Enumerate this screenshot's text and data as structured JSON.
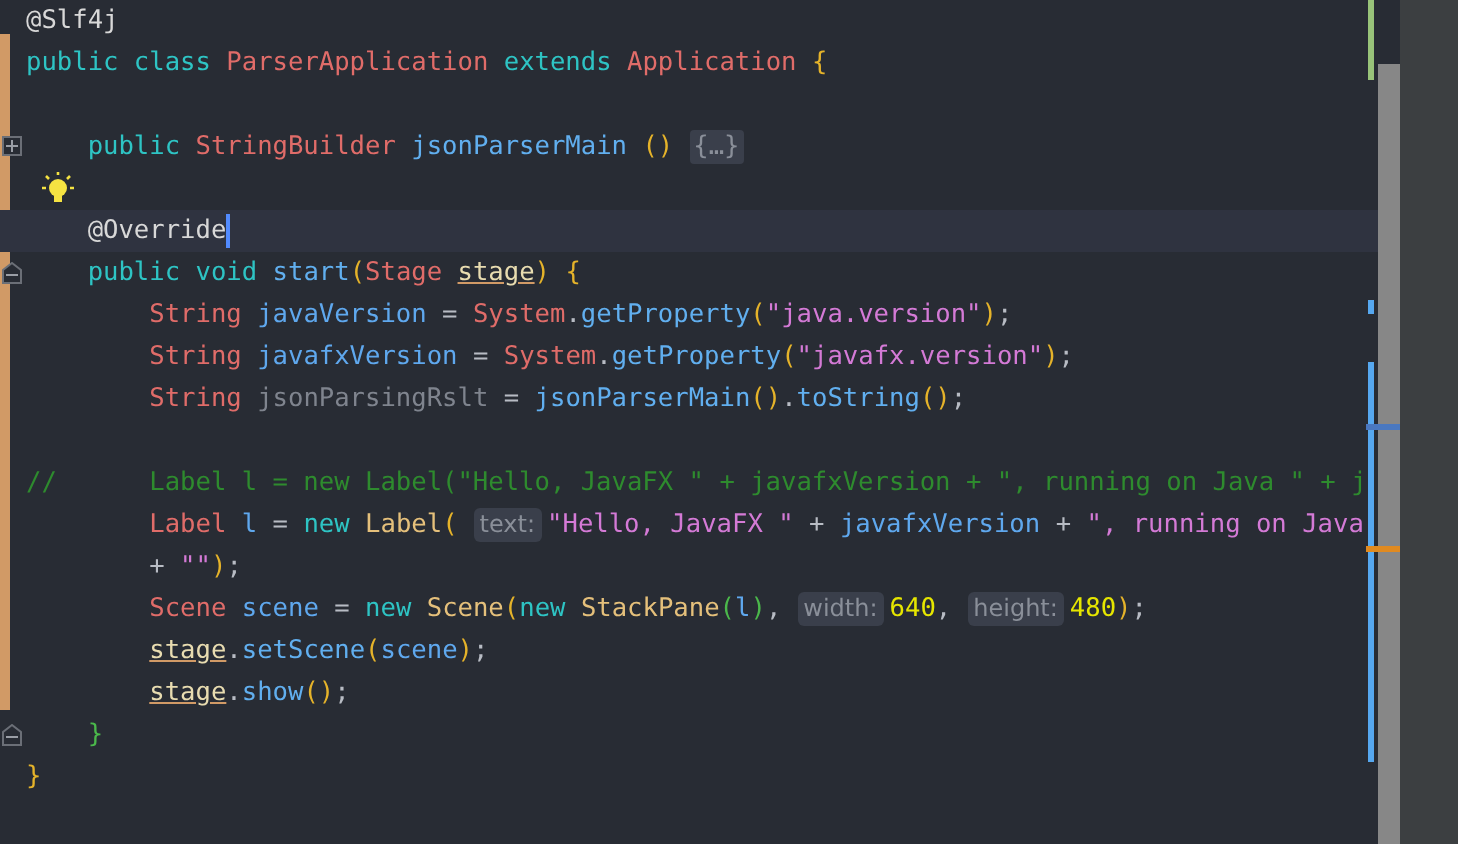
{
  "editor": {
    "lines": [
      {
        "tokens": [
          {
            "text": "@Slf4j",
            "kind": "annotation"
          }
        ]
      },
      {
        "tokens": [
          {
            "text": "public class ",
            "kind": "keyword"
          },
          {
            "text": "ParserApplication",
            "kind": "type"
          },
          {
            "text": " extends ",
            "kind": "keyword"
          },
          {
            "text": "Application",
            "kind": "type"
          },
          {
            "text": " {",
            "kind": "brace"
          }
        ]
      },
      {
        "blank_before": true,
        "folded": true,
        "tokens": [
          {
            "text": "    public ",
            "kind": "keyword"
          },
          {
            "text": "StringBuilder",
            "kind": "type"
          },
          {
            "text": " jsonParserMain ",
            "kind": "method"
          },
          {
            "text": "()",
            "kind": "brace"
          },
          {
            "text": "{…}",
            "kind": "folded"
          }
        ]
      },
      {
        "blank_before": true,
        "bulb": true,
        "current": true,
        "tokens": [
          {
            "text": "    @Override",
            "kind": "annotation"
          }
        ]
      },
      {
        "folded": false,
        "tokens": [
          {
            "text": "    public void ",
            "kind": "keyword"
          },
          {
            "text": "start",
            "kind": "method"
          },
          {
            "text": "(",
            "kind": "brace"
          },
          {
            "text": "Stage ",
            "kind": "type"
          },
          {
            "text": "stage",
            "kind": "param"
          },
          {
            "text": ")",
            "kind": "brace"
          },
          {
            "text": " {",
            "kind": "brace"
          }
        ]
      },
      {
        "tokens": [
          {
            "text": "        String ",
            "kind": "type"
          },
          {
            "text": "javaVersion",
            "kind": "ident"
          },
          {
            "text": " = ",
            "kind": "plain"
          },
          {
            "text": "System",
            "kind": "type"
          },
          {
            "text": ".",
            "kind": "plain"
          },
          {
            "text": "getProperty",
            "kind": "method"
          },
          {
            "text": "(",
            "kind": "brace"
          },
          {
            "text": "\"java.version\"",
            "kind": "string"
          },
          {
            "text": ")",
            "kind": "brace"
          },
          {
            "text": ";",
            "kind": "plain"
          }
        ]
      },
      {
        "tokens": [
          {
            "text": "        String ",
            "kind": "type"
          },
          {
            "text": "javafxVersion",
            "kind": "ident"
          },
          {
            "text": " = ",
            "kind": "plain"
          },
          {
            "text": "System",
            "kind": "type"
          },
          {
            "text": ".",
            "kind": "plain"
          },
          {
            "text": "getProperty",
            "kind": "method"
          },
          {
            "text": "(",
            "kind": "brace"
          },
          {
            "text": "\"javafx.version\"",
            "kind": "string"
          },
          {
            "text": ")",
            "kind": "brace"
          },
          {
            "text": ";",
            "kind": "plain"
          }
        ]
      },
      {
        "tokens": [
          {
            "text": "        String ",
            "kind": "type"
          },
          {
            "text": "jsonParsingRslt",
            "kind": "unused"
          },
          {
            "text": " = ",
            "kind": "plain"
          },
          {
            "text": "jsonParserMain",
            "kind": "method"
          },
          {
            "text": "()",
            "kind": "brace"
          },
          {
            "text": ".",
            "kind": "plain"
          },
          {
            "text": "toString",
            "kind": "method"
          },
          {
            "text": "()",
            "kind": "brace"
          },
          {
            "text": ";",
            "kind": "plain"
          }
        ]
      },
      {
        "blank_before": true,
        "tokens": [
          {
            "text": "//      Label l = new Label(\"Hello, JavaFX \" + javafxVersion + \", running on Java \" + j",
            "kind": "comment"
          }
        ]
      },
      {
        "tokens": [
          {
            "text": "        Label ",
            "kind": "type"
          },
          {
            "text": "l",
            "kind": "ident"
          },
          {
            "text": " = ",
            "kind": "plain"
          },
          {
            "text": "new ",
            "kind": "keyword"
          },
          {
            "text": "Label",
            "kind": "class"
          },
          {
            "text": "(",
            "kind": "brace"
          },
          {
            "text": "text:",
            "kind": "hint"
          },
          {
            "text": "\"Hello, JavaFX \"",
            "kind": "string"
          },
          {
            "text": " + ",
            "kind": "plain"
          },
          {
            "text": "javafxVersion",
            "kind": "ident"
          },
          {
            "text": " + ",
            "kind": "plain"
          },
          {
            "text": "\", running on Java",
            "kind": "string"
          }
        ]
      },
      {
        "tokens": [
          {
            "text": "        + ",
            "kind": "plain"
          },
          {
            "text": "\"\"",
            "kind": "string"
          },
          {
            "text": ")",
            "kind": "brace"
          },
          {
            "text": ";",
            "kind": "plain"
          }
        ]
      },
      {
        "tokens": [
          {
            "text": "        Scene ",
            "kind": "type"
          },
          {
            "text": "scene",
            "kind": "ident"
          },
          {
            "text": " = ",
            "kind": "plain"
          },
          {
            "text": "new ",
            "kind": "keyword"
          },
          {
            "text": "Scene",
            "kind": "class"
          },
          {
            "text": "(",
            "kind": "brace"
          },
          {
            "text": "new ",
            "kind": "keyword"
          },
          {
            "text": "StackPane",
            "kind": "class"
          },
          {
            "text": "(",
            "kind": "paren2"
          },
          {
            "text": "l",
            "kind": "ident"
          },
          {
            "text": ")",
            "kind": "paren2"
          },
          {
            "text": ",",
            "kind": "plain"
          },
          {
            "text": "width:",
            "kind": "hint"
          },
          {
            "text": "640",
            "kind": "number"
          },
          {
            "text": ",",
            "kind": "plain"
          },
          {
            "text": "height:",
            "kind": "hint"
          },
          {
            "text": "480",
            "kind": "number"
          },
          {
            "text": ")",
            "kind": "brace"
          },
          {
            "text": ";",
            "kind": "plain"
          }
        ]
      },
      {
        "tokens": [
          {
            "text": "        stage",
            "kind": "param"
          },
          {
            "text": ".",
            "kind": "plain"
          },
          {
            "text": "setScene",
            "kind": "method"
          },
          {
            "text": "(",
            "kind": "brace"
          },
          {
            "text": "scene",
            "kind": "ident"
          },
          {
            "text": ")",
            "kind": "brace"
          },
          {
            "text": ";",
            "kind": "plain"
          }
        ]
      },
      {
        "tokens": [
          {
            "text": "        stage",
            "kind": "param"
          },
          {
            "text": ".",
            "kind": "plain"
          },
          {
            "text": "show",
            "kind": "method"
          },
          {
            "text": "()",
            "kind": "brace"
          },
          {
            "text": ";",
            "kind": "plain"
          }
        ]
      },
      {
        "folded": false,
        "tokens": [
          {
            "text": "    }",
            "kind": "paren2"
          }
        ]
      },
      {
        "tokens": [
          {
            "text": "}",
            "kind": "brace"
          }
        ]
      }
    ]
  }
}
